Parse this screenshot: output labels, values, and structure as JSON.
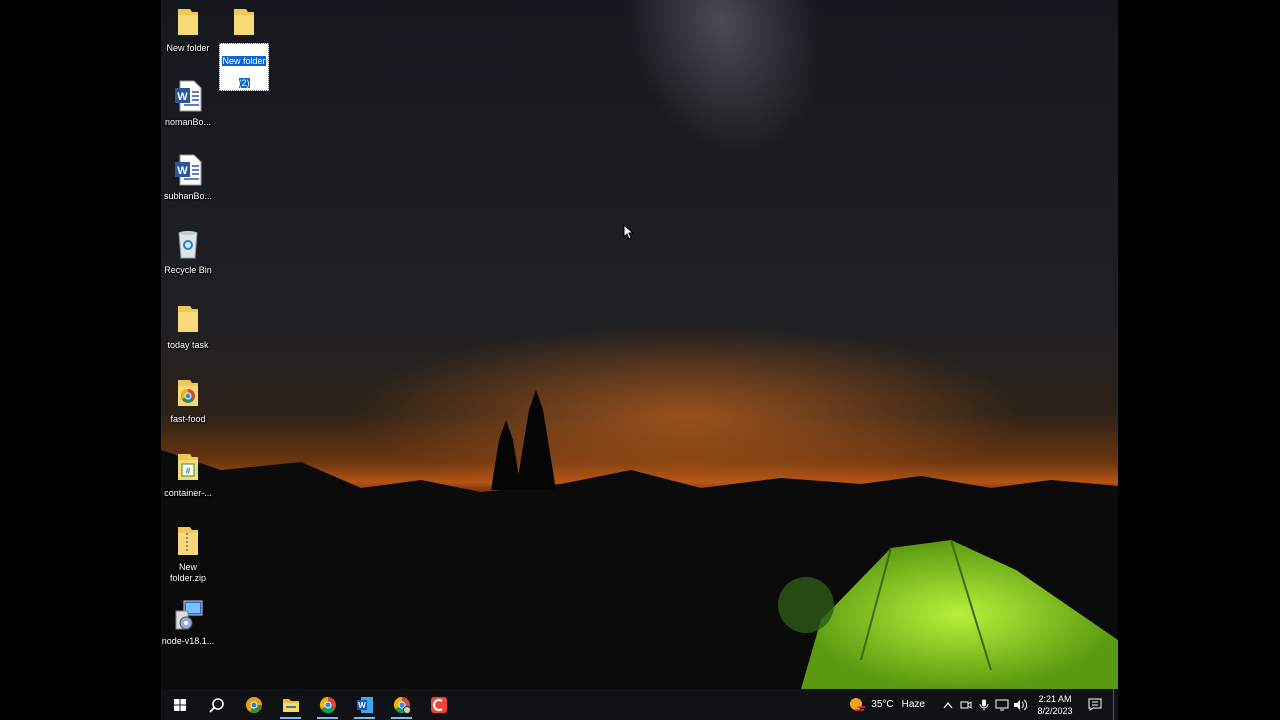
{
  "desktop": {
    "icons": [
      {
        "label": "New folder"
      },
      {
        "label": "New folder",
        "label2": "(2)"
      },
      {
        "label": "nomanBo..."
      },
      {
        "label": "subhanBo..."
      },
      {
        "label": "Recycle Bin"
      },
      {
        "label": "today task"
      },
      {
        "label": "fast-food"
      },
      {
        "label": "container-..."
      },
      {
        "label": "New\nfolder.zip"
      },
      {
        "label": "node-v18.1..."
      }
    ]
  },
  "taskbar": {
    "icons": [
      "windows-start-icon",
      "search-icon",
      "chrome-canary-icon",
      "file-explorer-icon",
      "chrome-icon",
      "word-icon",
      "chrome-profile-icon",
      "app-red-icon"
    ],
    "weather": {
      "temp": "35°C",
      "condition": "Haze"
    },
    "clock": {
      "time": "2:21 AM",
      "date": "8/2/2023"
    }
  },
  "colors": {
    "taskbar": "#101216",
    "selection": "#0a64d2",
    "tent": "#8ddc2a"
  }
}
